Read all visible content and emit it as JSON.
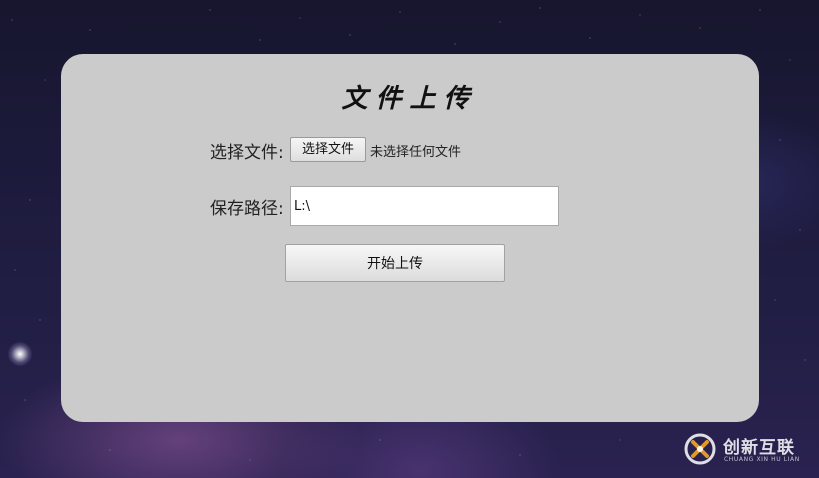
{
  "page": {
    "title": "文件上传"
  },
  "form": {
    "file_label": "选择文件:",
    "file_button_label": "选择文件",
    "file_status": "未选择任何文件",
    "path_label": "保存路径:",
    "path_value": "L:\\",
    "submit_label": "开始上传"
  },
  "watermark": {
    "name_cn": "创新互联",
    "name_en": "CHUANG XIN HU LIAN",
    "logo_icon": "chuangxin-logo-icon"
  },
  "colors": {
    "panel": "#cbcbcb",
    "logo_accent": "#e09a25"
  }
}
